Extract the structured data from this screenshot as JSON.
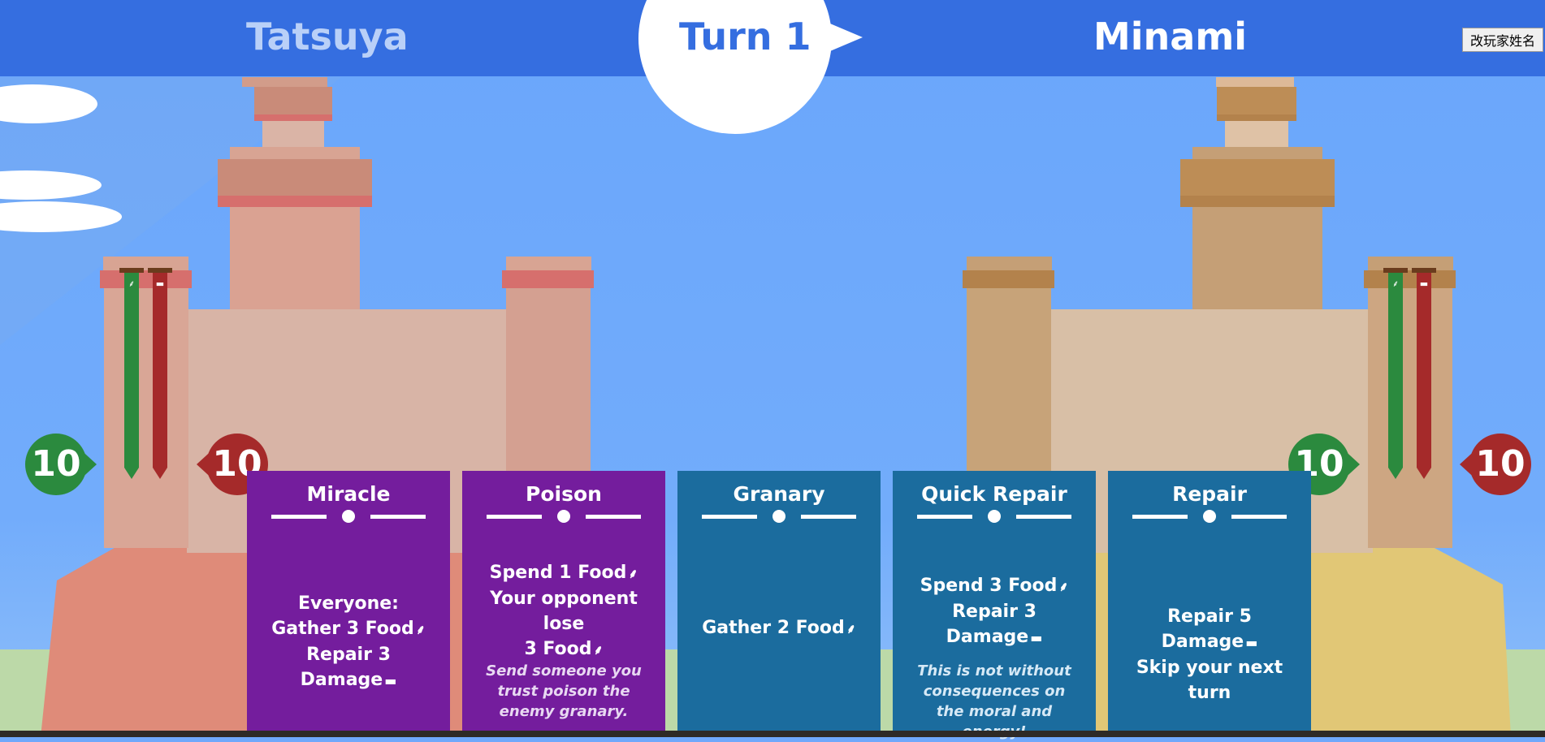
{
  "header": {
    "player1_name": "Tatsuya",
    "player2_name": "Minami",
    "turn_label": "Turn 1",
    "rename_button": "改玩家姓名"
  },
  "player1": {
    "food": "10",
    "damage": "10"
  },
  "player2": {
    "food": "10",
    "damage": "10"
  },
  "icons": {
    "food": "wheat-icon",
    "damage": "brick-icon",
    "food_glyph": "⸙",
    "damage_glyph": "▬"
  },
  "colors": {
    "header": "#356ee0",
    "sky": "#6fa8fb",
    "food_green": "#2b8a3e",
    "damage_red": "#a52a2a",
    "card_purple": "#741d9d",
    "card_teal": "#1b6c9e"
  },
  "cards": [
    {
      "title": "Miracle",
      "lines": [
        "Everyone:",
        "Gather 3 Food",
        "Repair 3 Damage"
      ],
      "flavor": ""
    },
    {
      "title": "Poison",
      "lines": [
        "Spend 1 Food",
        "Your opponent lose",
        "3 Food"
      ],
      "flavor": "Send someone you trust poison the enemy granary."
    },
    {
      "title": "Granary",
      "lines": [
        "Gather 2 Food"
      ],
      "flavor": ""
    },
    {
      "title": "Quick Repair",
      "lines": [
        "Spend 3 Food",
        "Repair 3 Damage"
      ],
      "flavor": "This is not without consequences on the moral and energy!"
    },
    {
      "title": "Repair",
      "lines": [
        "Repair 5 Damage",
        "Skip your next turn"
      ],
      "flavor": ""
    }
  ]
}
